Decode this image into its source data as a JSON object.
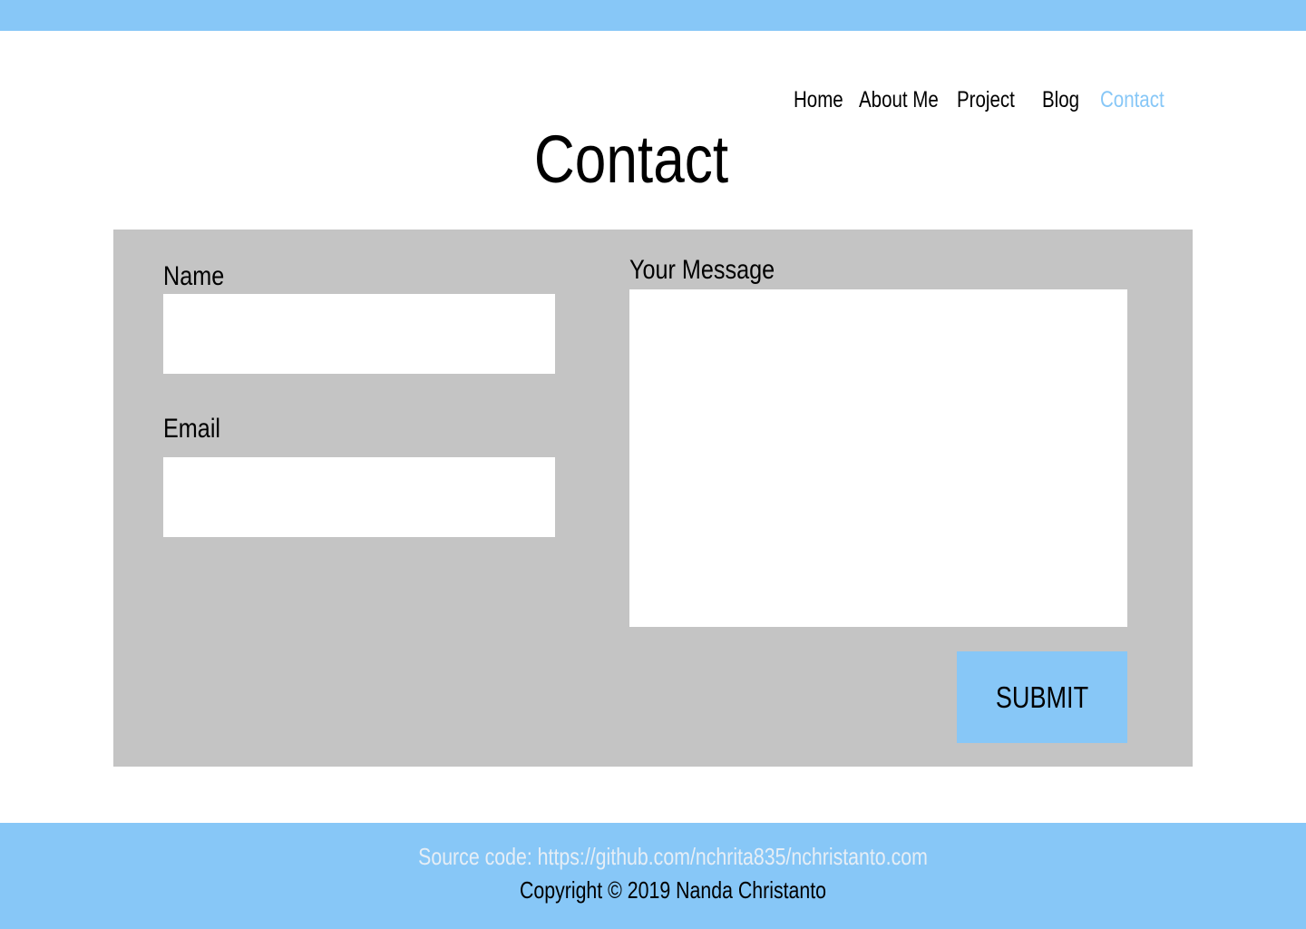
{
  "nav": {
    "items": [
      {
        "label": "Home"
      },
      {
        "label": "About Me"
      },
      {
        "label": "Project"
      },
      {
        "label": "Blog"
      },
      {
        "label": "Contact",
        "active": true
      }
    ]
  },
  "page": {
    "title": "Contact"
  },
  "form": {
    "name_label": "Name",
    "name_value": "",
    "email_label": "Email",
    "email_value": "",
    "message_label": "Your Message",
    "message_value": "",
    "submit_label": "SUBMIT"
  },
  "footer": {
    "source_prefix": "Source code: ",
    "source_link": "https://github.com/nchrita835/nchristanto.com",
    "copyright": "Copyright © 2019 Nanda Christanto"
  },
  "colors": {
    "accent": "#87c7f7",
    "panel": "#c4c4c4",
    "background": "#ffffff"
  }
}
